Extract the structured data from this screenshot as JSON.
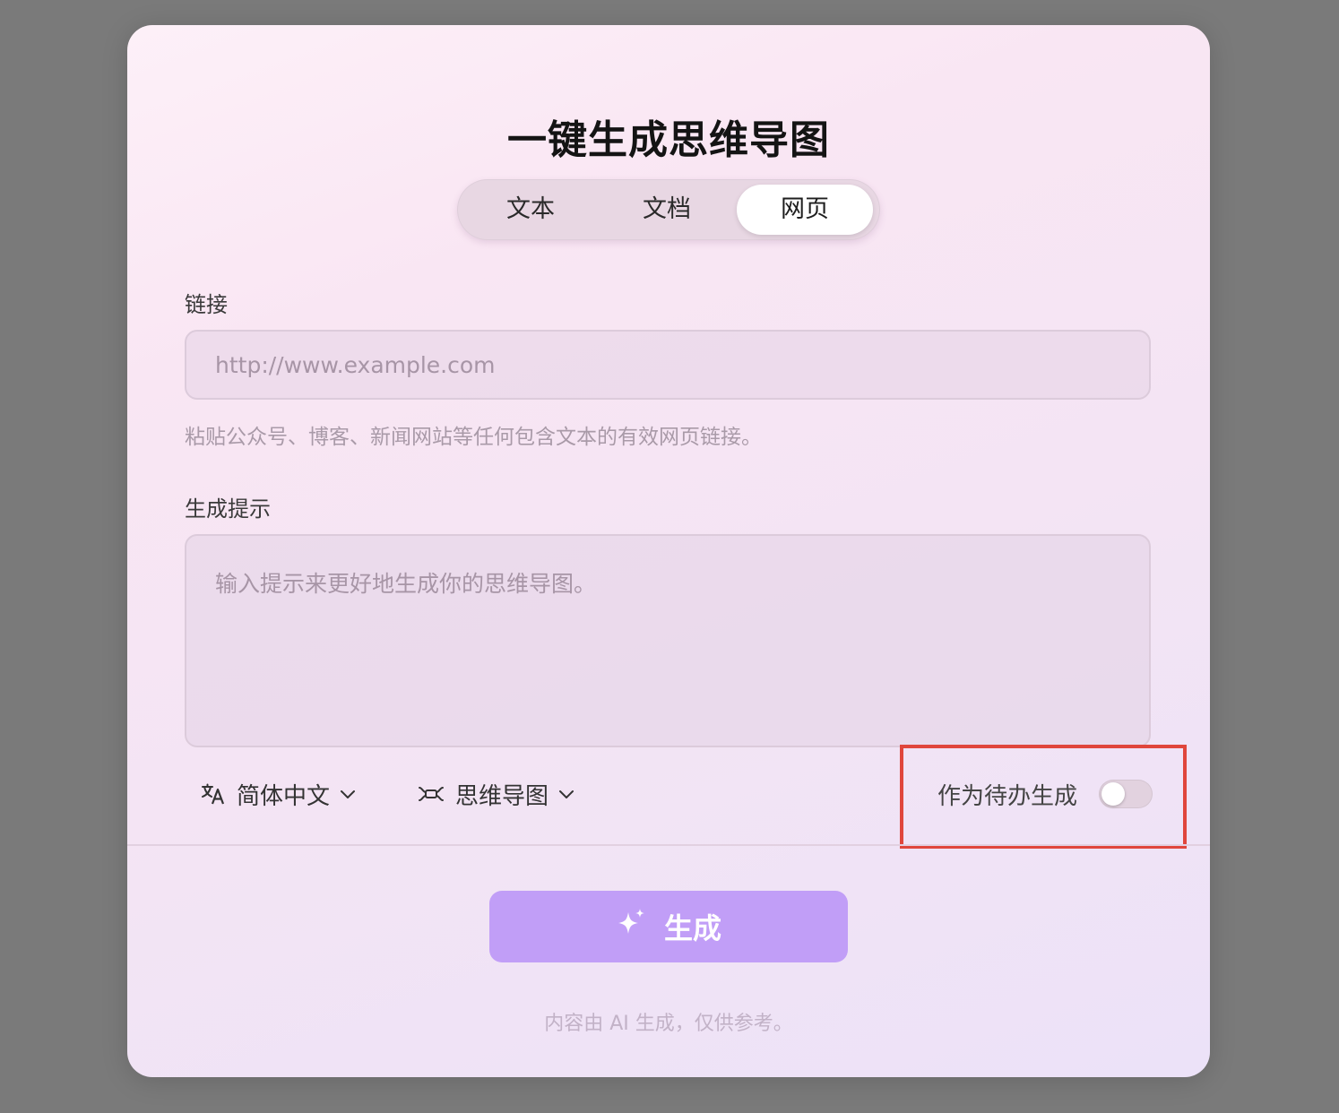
{
  "dialog": {
    "title": "一键生成思维导图",
    "tabs": [
      {
        "label": "文本",
        "active": false
      },
      {
        "label": "文档",
        "active": false
      },
      {
        "label": "网页",
        "active": true
      }
    ],
    "link": {
      "label": "链接",
      "placeholder": "http://www.example.com",
      "value": "",
      "hint": "粘贴公众号、博客、新闻网站等任何包含文本的有效网页链接。"
    },
    "prompt": {
      "label": "生成提示",
      "placeholder": "输入提示来更好地生成你的思维导图。",
      "value": ""
    },
    "options": {
      "language": {
        "icon": "translate-icon",
        "value": "简体中文"
      },
      "output_type": {
        "icon": "mindmap-icon",
        "value": "思维导图"
      },
      "todo": {
        "label": "作为待办生成",
        "enabled": false
      }
    },
    "generate_button": {
      "icon": "sparkle-icon",
      "label": "生成"
    },
    "footer_note": "内容由 AI 生成，仅供参考。"
  },
  "colors": {
    "accent_button": "#c19ef7",
    "highlight_box": "#e0463c",
    "backdrop": "#7a7a7a"
  }
}
